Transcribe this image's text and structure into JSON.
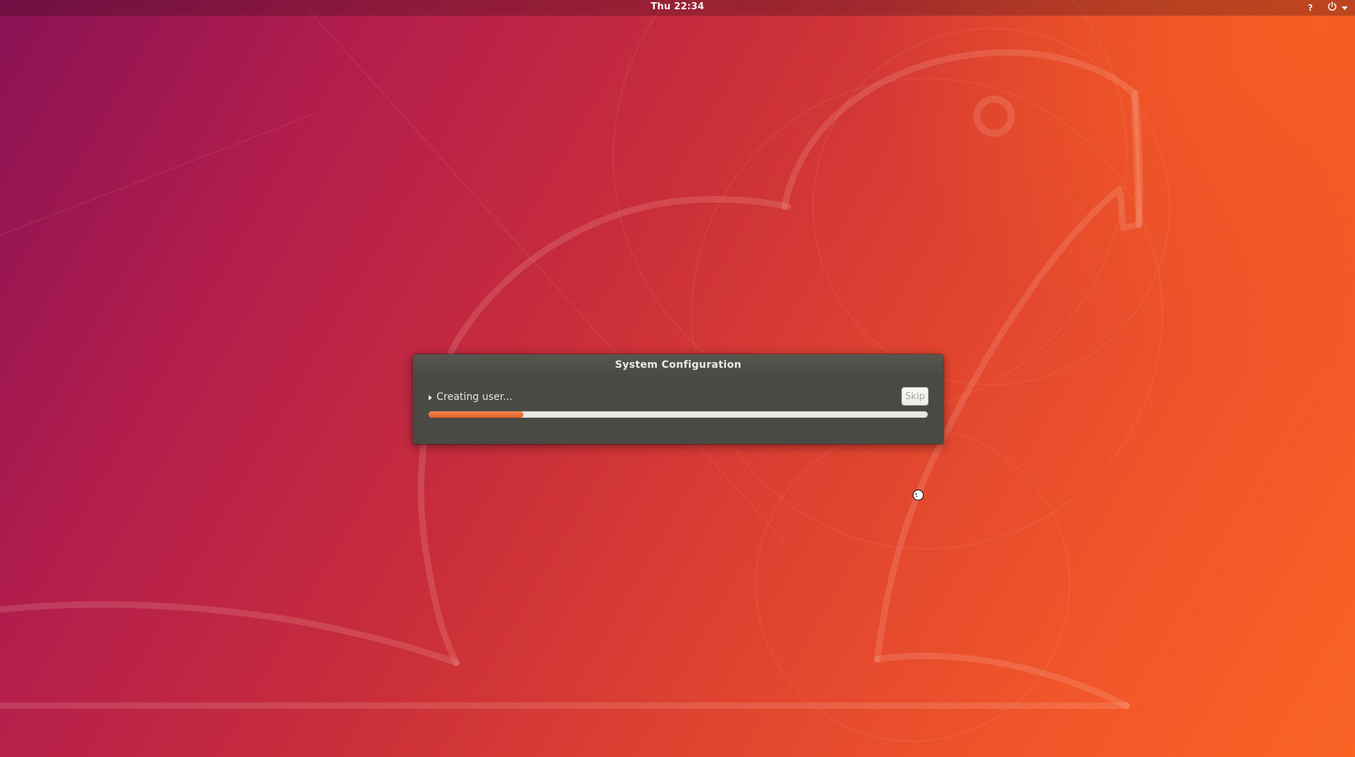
{
  "top_bar": {
    "clock": "Thu 22:34",
    "help_label": "?",
    "power_icon": "power-icon",
    "menu_arrow_icon": "chevron-down-icon"
  },
  "dialog": {
    "title": "System Configuration",
    "expander_label": "Creating user...",
    "expander_icon": "expander-arrow-icon",
    "skip_button_label": "Skip",
    "skip_button_enabled": false,
    "progress_fraction": 0.19
  },
  "cursor": {
    "icon": "busy-cursor-icon"
  },
  "colors": {
    "accent": "#e95420",
    "dialog_bg": "#4a4a45",
    "wallpaper_primary": "#c82d3b",
    "wallpaper_secondary": "#8a1255"
  }
}
